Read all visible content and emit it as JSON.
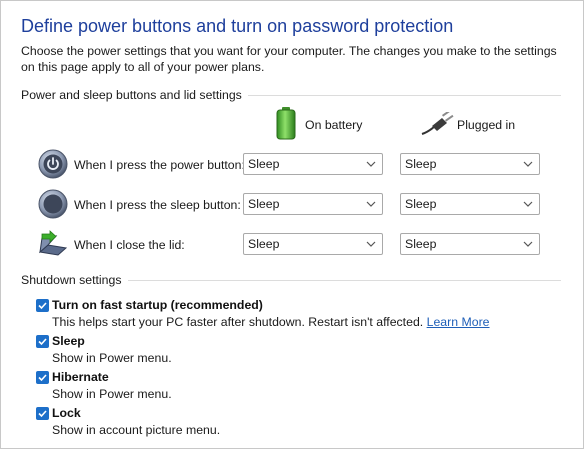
{
  "header": {
    "title": "Define power buttons and turn on password protection",
    "description": "Choose the power settings that you want for your computer. The changes you make to the settings on this page apply to all of your power plans."
  },
  "power_section": {
    "heading": "Power and sleep buttons and lid settings",
    "columns": {
      "battery": {
        "label": "On battery",
        "icon": "battery-icon"
      },
      "plugged": {
        "label": "Plugged in",
        "icon": "power-plug-icon"
      }
    },
    "rows": [
      {
        "label": "When I press the power button:",
        "icon": "power-button-icon",
        "battery_value": "Sleep",
        "plugged_value": "Sleep"
      },
      {
        "label": "When I press the sleep button:",
        "icon": "sleep-button-icon",
        "battery_value": "Sleep",
        "plugged_value": "Sleep"
      },
      {
        "label": "When I close the lid:",
        "icon": "laptop-lid-icon",
        "battery_value": "Sleep",
        "plugged_value": "Sleep"
      }
    ]
  },
  "shutdown_section": {
    "heading": "Shutdown settings",
    "items": [
      {
        "label": "Turn on fast startup (recommended)",
        "description": "This helps start your PC faster after shutdown. Restart isn't affected.",
        "link": "Learn More",
        "checked": true
      },
      {
        "label": "Sleep",
        "description": "Show in Power menu.",
        "checked": true
      },
      {
        "label": "Hibernate",
        "description": "Show in Power menu.",
        "checked": true
      },
      {
        "label": "Lock",
        "description": "Show in account picture menu.",
        "checked": true
      }
    ]
  },
  "colors": {
    "title": "#1e3f9c",
    "checkbox": "#1d6fc9",
    "link": "#1f5fb8"
  }
}
